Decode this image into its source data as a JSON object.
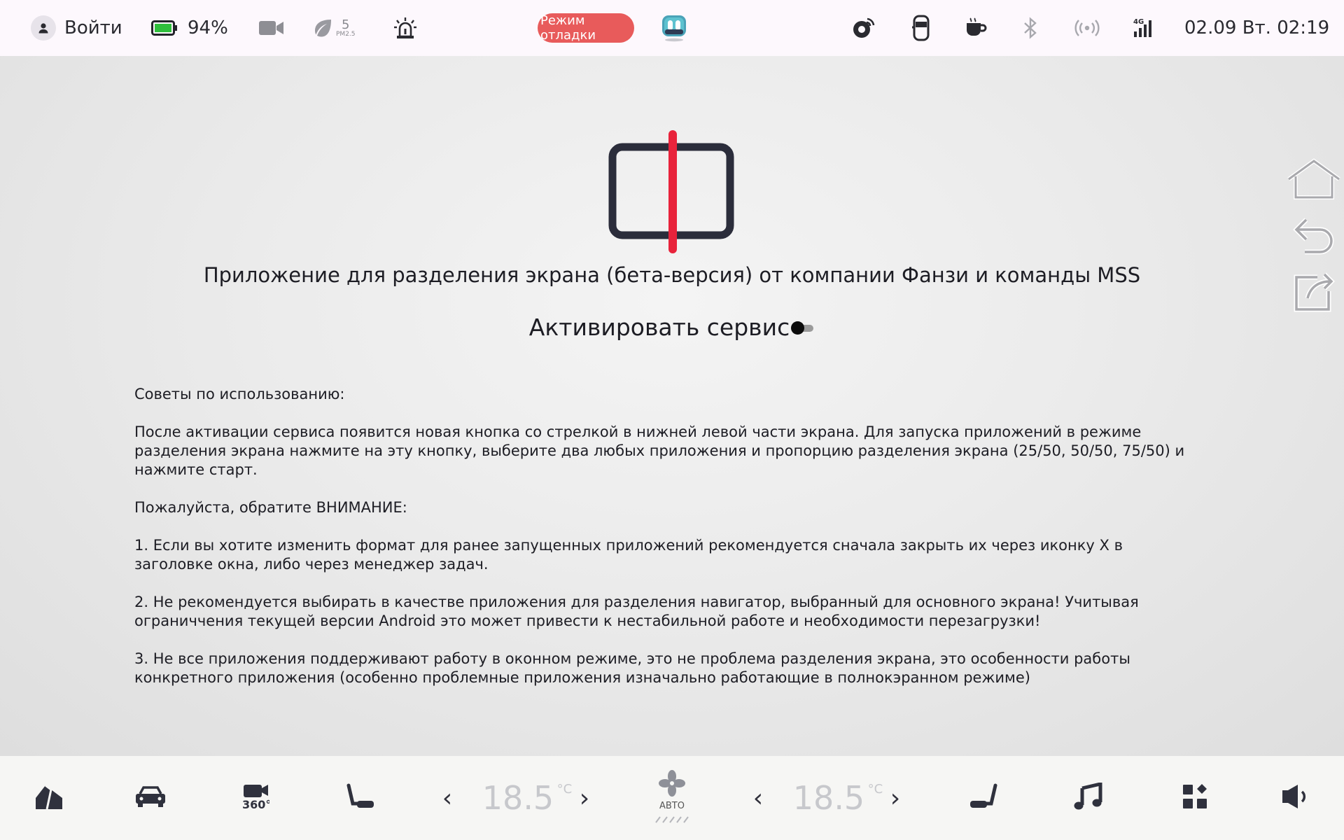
{
  "status_bar": {
    "login_label": "Войти",
    "battery_percent": "94%",
    "pm_value": "5",
    "pm_unit": "PM2.5",
    "debug_mode_label": "Режим отладки",
    "datetime": "02.09 Вт. 02:19",
    "icons": [
      "user-icon",
      "battery-icon",
      "camera-icon",
      "leaf-icon",
      "alarm-icon",
      "robot-app-icon",
      "tire-pressure-icon",
      "door-icon",
      "cup-icon",
      "bluetooth-icon",
      "hotspot-icon",
      "signal-4g-icon"
    ]
  },
  "main": {
    "title": "Приложение для разделения экрана (бета-версия) от компании Фанзи и команды MSS",
    "activate_label": "Активировать сервис",
    "activate_enabled": false,
    "tips": {
      "heading": "Советы по использованию:",
      "intro": "После активации сервиса появится новая кнопка со стрелкой в нижней левой части экрана. Для запуска приложений в режиме разделения экрана нажмите на эту кнопку, выберите два любых приложения и пропорцию разделения экрана (25/50, 50/50, 75/50) и нажмите старт.",
      "attention": "Пожалуйста, обратите ВНИМАНИЕ:",
      "items": [
        "1. Если вы хотите изменить формат для ранее запущенных приложений рекомендуется сначала закрыть их через иконку Х в заголовке окна, либо через менеджер задач.",
        "2. Не рекомендуется выбирать в качестве приложения для разделения навигатор, выбранный для основного экрана! Учитывая ограниччения текущей версии Android это может привести к нестабильной работе и необходимости перезагрузки!",
        "3. Не все приложения поддерживают работу в оконном режиме, это не проблема разделения экрана, это особенности работы конкретного приложения (особенно проблемные приложения изначально работающие в полнокэранном режиме)"
      ]
    },
    "side_controls": [
      "home-icon",
      "back-icon",
      "share-icon"
    ]
  },
  "dock": {
    "left_temp": "18.5",
    "right_temp": "18.5",
    "temp_unit": "°C",
    "fan_mode_label": "АВТО",
    "chevron_left": "‹",
    "chevron_right": "›",
    "camera_360_label": "360°"
  },
  "colors": {
    "accent_red": "#e8233b",
    "debug_pill": "#e85b5b",
    "icon_dark": "#2b2d3b",
    "temp_grey": "#c7c8cc"
  }
}
